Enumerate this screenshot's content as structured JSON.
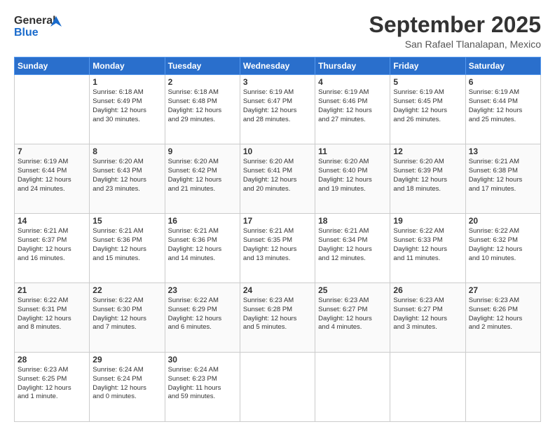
{
  "header": {
    "logo_text_general": "General",
    "logo_text_blue": "Blue",
    "month_title": "September 2025",
    "location": "San Rafael Tlanalapan, Mexico"
  },
  "days_of_week": [
    "Sunday",
    "Monday",
    "Tuesday",
    "Wednesday",
    "Thursday",
    "Friday",
    "Saturday"
  ],
  "weeks": [
    [
      {
        "day": "",
        "info": ""
      },
      {
        "day": "1",
        "info": "Sunrise: 6:18 AM\nSunset: 6:49 PM\nDaylight: 12 hours\nand 30 minutes."
      },
      {
        "day": "2",
        "info": "Sunrise: 6:18 AM\nSunset: 6:48 PM\nDaylight: 12 hours\nand 29 minutes."
      },
      {
        "day": "3",
        "info": "Sunrise: 6:19 AM\nSunset: 6:47 PM\nDaylight: 12 hours\nand 28 minutes."
      },
      {
        "day": "4",
        "info": "Sunrise: 6:19 AM\nSunset: 6:46 PM\nDaylight: 12 hours\nand 27 minutes."
      },
      {
        "day": "5",
        "info": "Sunrise: 6:19 AM\nSunset: 6:45 PM\nDaylight: 12 hours\nand 26 minutes."
      },
      {
        "day": "6",
        "info": "Sunrise: 6:19 AM\nSunset: 6:44 PM\nDaylight: 12 hours\nand 25 minutes."
      }
    ],
    [
      {
        "day": "7",
        "info": "Sunrise: 6:19 AM\nSunset: 6:44 PM\nDaylight: 12 hours\nand 24 minutes."
      },
      {
        "day": "8",
        "info": "Sunrise: 6:20 AM\nSunset: 6:43 PM\nDaylight: 12 hours\nand 23 minutes."
      },
      {
        "day": "9",
        "info": "Sunrise: 6:20 AM\nSunset: 6:42 PM\nDaylight: 12 hours\nand 21 minutes."
      },
      {
        "day": "10",
        "info": "Sunrise: 6:20 AM\nSunset: 6:41 PM\nDaylight: 12 hours\nand 20 minutes."
      },
      {
        "day": "11",
        "info": "Sunrise: 6:20 AM\nSunset: 6:40 PM\nDaylight: 12 hours\nand 19 minutes."
      },
      {
        "day": "12",
        "info": "Sunrise: 6:20 AM\nSunset: 6:39 PM\nDaylight: 12 hours\nand 18 minutes."
      },
      {
        "day": "13",
        "info": "Sunrise: 6:21 AM\nSunset: 6:38 PM\nDaylight: 12 hours\nand 17 minutes."
      }
    ],
    [
      {
        "day": "14",
        "info": "Sunrise: 6:21 AM\nSunset: 6:37 PM\nDaylight: 12 hours\nand 16 minutes."
      },
      {
        "day": "15",
        "info": "Sunrise: 6:21 AM\nSunset: 6:36 PM\nDaylight: 12 hours\nand 15 minutes."
      },
      {
        "day": "16",
        "info": "Sunrise: 6:21 AM\nSunset: 6:36 PM\nDaylight: 12 hours\nand 14 minutes."
      },
      {
        "day": "17",
        "info": "Sunrise: 6:21 AM\nSunset: 6:35 PM\nDaylight: 12 hours\nand 13 minutes."
      },
      {
        "day": "18",
        "info": "Sunrise: 6:21 AM\nSunset: 6:34 PM\nDaylight: 12 hours\nand 12 minutes."
      },
      {
        "day": "19",
        "info": "Sunrise: 6:22 AM\nSunset: 6:33 PM\nDaylight: 12 hours\nand 11 minutes."
      },
      {
        "day": "20",
        "info": "Sunrise: 6:22 AM\nSunset: 6:32 PM\nDaylight: 12 hours\nand 10 minutes."
      }
    ],
    [
      {
        "day": "21",
        "info": "Sunrise: 6:22 AM\nSunset: 6:31 PM\nDaylight: 12 hours\nand 8 minutes."
      },
      {
        "day": "22",
        "info": "Sunrise: 6:22 AM\nSunset: 6:30 PM\nDaylight: 12 hours\nand 7 minutes."
      },
      {
        "day": "23",
        "info": "Sunrise: 6:22 AM\nSunset: 6:29 PM\nDaylight: 12 hours\nand 6 minutes."
      },
      {
        "day": "24",
        "info": "Sunrise: 6:23 AM\nSunset: 6:28 PM\nDaylight: 12 hours\nand 5 minutes."
      },
      {
        "day": "25",
        "info": "Sunrise: 6:23 AM\nSunset: 6:27 PM\nDaylight: 12 hours\nand 4 minutes."
      },
      {
        "day": "26",
        "info": "Sunrise: 6:23 AM\nSunset: 6:27 PM\nDaylight: 12 hours\nand 3 minutes."
      },
      {
        "day": "27",
        "info": "Sunrise: 6:23 AM\nSunset: 6:26 PM\nDaylight: 12 hours\nand 2 minutes."
      }
    ],
    [
      {
        "day": "28",
        "info": "Sunrise: 6:23 AM\nSunset: 6:25 PM\nDaylight: 12 hours\nand 1 minute."
      },
      {
        "day": "29",
        "info": "Sunrise: 6:24 AM\nSunset: 6:24 PM\nDaylight: 12 hours\nand 0 minutes."
      },
      {
        "day": "30",
        "info": "Sunrise: 6:24 AM\nSunset: 6:23 PM\nDaylight: 11 hours\nand 59 minutes."
      },
      {
        "day": "",
        "info": ""
      },
      {
        "day": "",
        "info": ""
      },
      {
        "day": "",
        "info": ""
      },
      {
        "day": "",
        "info": ""
      }
    ]
  ]
}
